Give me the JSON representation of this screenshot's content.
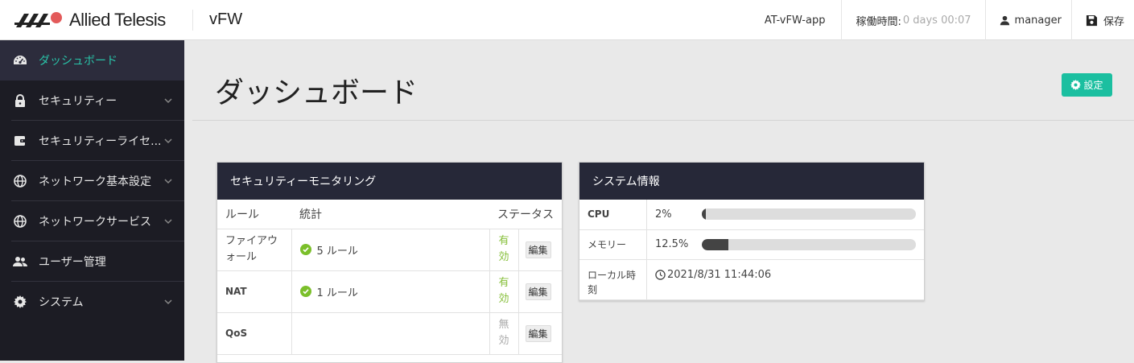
{
  "header": {
    "brand": "Allied Telesis",
    "app_title": "vFW",
    "device_name": "AT-vFW-app",
    "uptime_label": "稼働時間:",
    "uptime_value": "0 days 00:07",
    "user": "manager",
    "save_label": "保存"
  },
  "sidebar": {
    "items": [
      {
        "label": "ダッシュボード",
        "icon": "dashboard-icon",
        "active": true
      },
      {
        "label": "セキュリティー",
        "icon": "lock-icon"
      },
      {
        "label": "セキュリティーライセ...",
        "icon": "wallet-icon"
      },
      {
        "label": "ネットワーク基本設定",
        "icon": "globe-icon"
      },
      {
        "label": "ネットワークサービス",
        "icon": "globe-icon"
      },
      {
        "label": "ユーザー管理",
        "icon": "users-icon"
      },
      {
        "label": "システム",
        "icon": "gear-icon"
      }
    ]
  },
  "main": {
    "title": "ダッシュボード",
    "settings_label": "設定"
  },
  "security_card": {
    "title": "セキュリティーモニタリング",
    "headers": {
      "rule": "ルール",
      "stats": "統計",
      "status": "ステータス"
    },
    "rows": [
      {
        "rule": "ファイアウォール",
        "stats": "5 ルール",
        "status": "有効",
        "edit": "編集"
      },
      {
        "rule": "NAT",
        "stats": "1 ルール",
        "status": "有効",
        "edit": "編集"
      },
      {
        "rule": "QoS",
        "stats": "",
        "status": "無効",
        "edit": "編集"
      }
    ]
  },
  "system_card": {
    "title": "システム情報",
    "cpu_label": "CPU",
    "cpu_value": "2%",
    "cpu_fraction": 0.02,
    "memory_label": "メモリー",
    "memory_value": "12.5%",
    "memory_fraction": 0.125,
    "local_time_label": "ローカル時刻",
    "local_time_value": "2021/8/31 11:44:06"
  },
  "colors": {
    "accent": "#1bbfa0",
    "sidebar_bg": "#1c1c24",
    "card_head": "#262838",
    "enabled": "#86bf3a"
  }
}
